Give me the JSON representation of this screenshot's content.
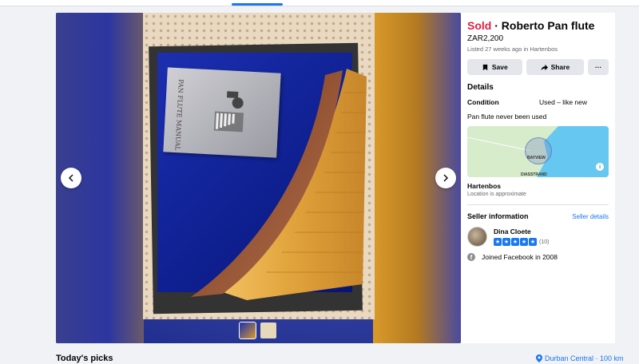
{
  "listing": {
    "status": "Sold",
    "separator": " · ",
    "title": "Roberto Pan flute",
    "price": "ZAR2,200",
    "listed": "Listed 27 weeks ago in Hartenbos"
  },
  "actions": {
    "save_label": "Save",
    "share_label": "Share",
    "more_label": "···"
  },
  "details": {
    "heading": "Details",
    "condition_key": "Condition",
    "condition_value": "Used – like new",
    "description": "Pan flute never been used"
  },
  "map": {
    "label_main": "BAYVIEW",
    "label_secondary": "DIASSTRAND",
    "info_icon": "i"
  },
  "location": {
    "name": "Hartenbos",
    "note": "Location is approximate"
  },
  "seller": {
    "heading": "Seller information",
    "details_link": "Seller details",
    "name": "Dina Cloete",
    "rating_stars": 5,
    "rating_count": "(10)",
    "joined": "Joined Facebook in 2008"
  },
  "photo": {
    "manual_text": "PAN FLUTE MANUAL"
  },
  "feed": {
    "heading": "Today's picks",
    "location_filter": "Durban Central · 100 km"
  },
  "colors": {
    "sold": "#e41e3f",
    "link": "#1877f2",
    "button_bg": "#e4e6eb",
    "page_bg": "#f0f2f5"
  },
  "icons": [
    "chevron-left-icon",
    "chevron-right-icon",
    "bookmark-icon",
    "share-icon",
    "star-icon",
    "facebook-icon",
    "location-pin-icon",
    "info-icon"
  ]
}
